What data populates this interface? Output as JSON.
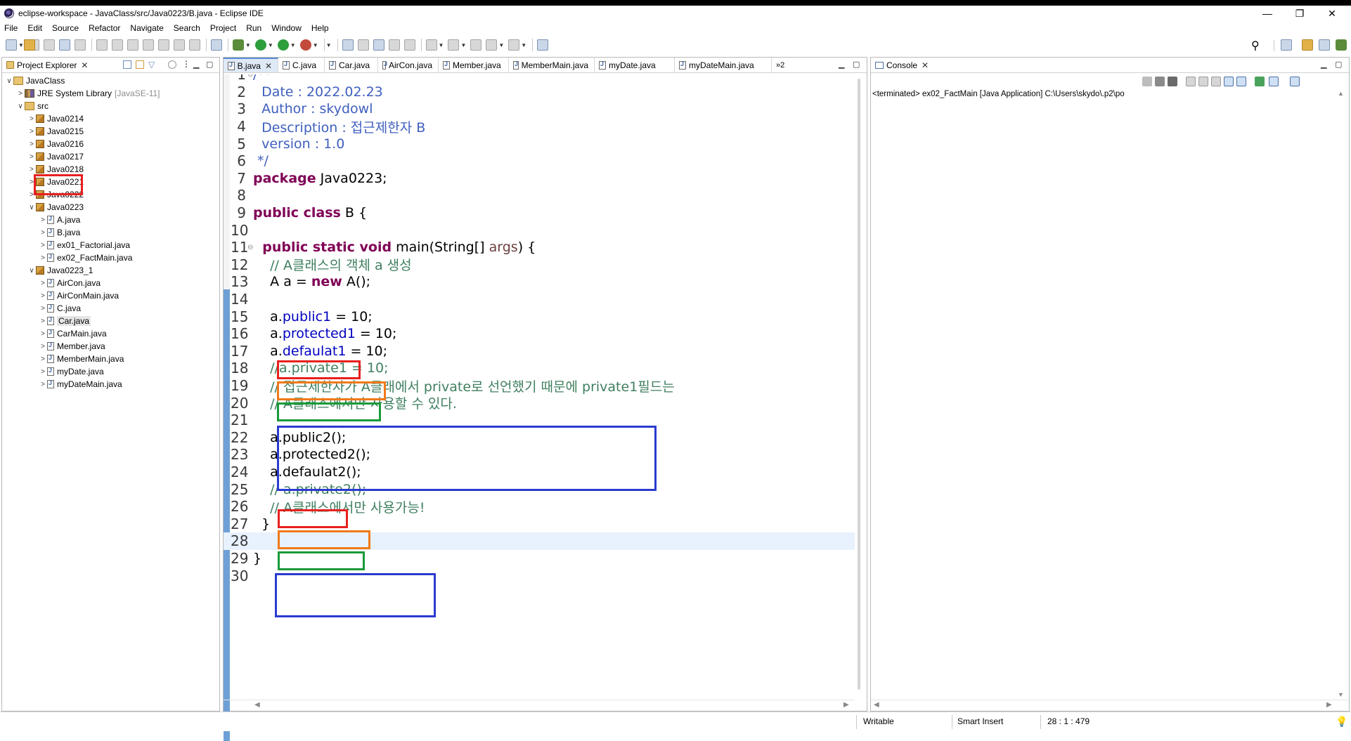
{
  "window": {
    "title": "eclipse-workspace - JavaClass/src/Java0223/B.java - Eclipse IDE",
    "controls": [
      "—",
      "❐",
      "✕"
    ]
  },
  "menu": [
    "File",
    "Edit",
    "Source",
    "Refactor",
    "Navigate",
    "Search",
    "Project",
    "Run",
    "Window",
    "Help"
  ],
  "explorer": {
    "title": "Project Explorer",
    "tree": [
      {
        "label": "JavaClass",
        "kind": "project",
        "chev": "∨",
        "depth": 0
      },
      {
        "label": "JRE System Library",
        "extra": "[JavaSE-11]",
        "kind": "library",
        "chev": ">",
        "depth": 1
      },
      {
        "label": "src",
        "kind": "src",
        "chev": "∨",
        "depth": 1
      },
      {
        "label": "Java0214",
        "kind": "package",
        "chev": ">",
        "depth": 2
      },
      {
        "label": "Java0215",
        "kind": "package",
        "chev": ">",
        "depth": 2
      },
      {
        "label": "Java0216",
        "kind": "package",
        "chev": ">",
        "depth": 2
      },
      {
        "label": "Java0217",
        "kind": "package",
        "chev": ">",
        "depth": 2
      },
      {
        "label": "Java0218",
        "kind": "package",
        "chev": ">",
        "depth": 2
      },
      {
        "label": "Java0221",
        "kind": "package",
        "chev": ">",
        "depth": 2
      },
      {
        "label": "Java0222",
        "kind": "package",
        "chev": ">",
        "depth": 2
      },
      {
        "label": "Java0223",
        "kind": "package",
        "chev": "∨",
        "depth": 2
      },
      {
        "label": "A.java",
        "kind": "file",
        "chev": ">",
        "depth": 3
      },
      {
        "label": "B.java",
        "kind": "file",
        "chev": ">",
        "depth": 3
      },
      {
        "label": "ex01_Factorial.java",
        "kind": "file",
        "chev": ">",
        "depth": 3
      },
      {
        "label": "ex02_FactMain.java",
        "kind": "file",
        "chev": ">",
        "depth": 3
      },
      {
        "label": "Java0223_1",
        "kind": "package",
        "chev": "∨",
        "depth": 2
      },
      {
        "label": "AirCon.java",
        "kind": "file",
        "chev": ">",
        "depth": 3
      },
      {
        "label": "AirConMain.java",
        "kind": "file",
        "chev": ">",
        "depth": 3
      },
      {
        "label": "C.java",
        "kind": "file",
        "chev": ">",
        "depth": 3
      },
      {
        "label": "Car.java",
        "kind": "file",
        "chev": ">",
        "depth": 3,
        "selected": true
      },
      {
        "label": "CarMain.java",
        "kind": "file",
        "chev": ">",
        "depth": 3
      },
      {
        "label": "Member.java",
        "kind": "file",
        "chev": ">",
        "depth": 3
      },
      {
        "label": "MemberMain.java",
        "kind": "file",
        "chev": ">",
        "depth": 3
      },
      {
        "label": "myDate.java",
        "kind": "file",
        "chev": ">",
        "depth": 3
      },
      {
        "label": "myDateMain.java",
        "kind": "file",
        "chev": ">",
        "depth": 3
      }
    ]
  },
  "editor": {
    "tabs": [
      "B.java",
      "C.java",
      "Car.java",
      "AirCon.java",
      "Member.java",
      "MemberMain.java",
      "myDate.java",
      "myDateMain.java"
    ],
    "overflow": "»2",
    "lines": [
      {
        "n": "1",
        "tokens": [
          {
            "t": "/**",
            "c": "doc"
          }
        ],
        "fold": "⊖"
      },
      {
        "n": "2",
        "tokens": [
          {
            "t": "  Date : 2022.02.23",
            "c": "doc"
          }
        ]
      },
      {
        "n": "3",
        "tokens": [
          {
            "t": "  Author : skydowl",
            "c": "doc"
          }
        ]
      },
      {
        "n": "4",
        "tokens": [
          {
            "t": "  Description : 접근제한자 B",
            "c": "doc"
          }
        ]
      },
      {
        "n": "5",
        "tokens": [
          {
            "t": "  version : 1.0",
            "c": "doc"
          }
        ]
      },
      {
        "n": "6",
        "tokens": [
          {
            "t": " */",
            "c": "doc"
          }
        ]
      },
      {
        "n": "7",
        "tokens": [
          {
            "t": "package",
            "c": "kw"
          },
          {
            "t": " Java0223;",
            "c": ""
          }
        ]
      },
      {
        "n": "8",
        "tokens": []
      },
      {
        "n": "9",
        "tokens": [
          {
            "t": "public class",
            "c": "kw"
          },
          {
            "t": " B {",
            "c": ""
          }
        ]
      },
      {
        "n": "10",
        "tokens": []
      },
      {
        "n": "11",
        "tokens": [
          {
            "t": "  public static void",
            "c": "kw"
          },
          {
            "t": " main(String[] ",
            "c": ""
          },
          {
            "t": "args",
            "c": "param"
          },
          {
            "t": ") {",
            "c": ""
          }
        ],
        "fold": "⊖"
      },
      {
        "n": "12",
        "tokens": [
          {
            "t": "    // A클래스의 객체 a 생성",
            "c": "cmt"
          }
        ]
      },
      {
        "n": "13",
        "tokens": [
          {
            "t": "    A a = ",
            "c": ""
          },
          {
            "t": "new",
            "c": "kw"
          },
          {
            "t": " A();",
            "c": ""
          }
        ]
      },
      {
        "n": "14",
        "tokens": []
      },
      {
        "n": "15",
        "tokens": [
          {
            "t": "    a.",
            "c": ""
          },
          {
            "t": "public1",
            "c": "fld"
          },
          {
            "t": " = 10;",
            "c": ""
          }
        ]
      },
      {
        "n": "16",
        "tokens": [
          {
            "t": "    a.",
            "c": ""
          },
          {
            "t": "protected1",
            "c": "fld"
          },
          {
            "t": " = 10;",
            "c": ""
          }
        ]
      },
      {
        "n": "17",
        "tokens": [
          {
            "t": "    a.",
            "c": ""
          },
          {
            "t": "defaulat1",
            "c": "fld"
          },
          {
            "t": " = 10;",
            "c": ""
          }
        ]
      },
      {
        "n": "18",
        "tokens": [
          {
            "t": "    //a.private1 = 10;",
            "c": "cmt"
          }
        ]
      },
      {
        "n": "19",
        "tokens": [
          {
            "t": "    // 접근제한자가 A클래에서 private로 선언했기 때문에 private1필드는",
            "c": "cmt"
          }
        ]
      },
      {
        "n": "20",
        "tokens": [
          {
            "t": "    // A클래스에서만 사용할 수 있다.",
            "c": "cmt"
          }
        ]
      },
      {
        "n": "21",
        "tokens": []
      },
      {
        "n": "22",
        "tokens": [
          {
            "t": "    a.public2();",
            "c": ""
          }
        ]
      },
      {
        "n": "23",
        "tokens": [
          {
            "t": "    a.protected2();",
            "c": ""
          }
        ]
      },
      {
        "n": "24",
        "tokens": [
          {
            "t": "    a.defaulat2();",
            "c": ""
          }
        ]
      },
      {
        "n": "25",
        "tokens": [
          {
            "t": "    // a.private2();",
            "c": "cmt"
          }
        ]
      },
      {
        "n": "26",
        "tokens": [
          {
            "t": "    // A클래스에서만 사용가능!",
            "c": "cmt"
          }
        ]
      },
      {
        "n": "27",
        "tokens": [
          {
            "t": "  }",
            "c": ""
          }
        ]
      },
      {
        "n": "28",
        "tokens": [],
        "current": true
      },
      {
        "n": "29",
        "tokens": [
          {
            "t": "}",
            "c": ""
          }
        ]
      },
      {
        "n": "30",
        "tokens": []
      }
    ]
  },
  "console": {
    "title": "Console",
    "text": "<terminated> ex02_FactMain [Java Application] C:\\Users\\skydo\\.p2\\po"
  },
  "status": {
    "writable": "Writable",
    "insert_mode": "Smart Insert",
    "position": "28 : 1 : 479"
  },
  "colors": {
    "annotation_red": "#e8201e",
    "annotation_orange": "#f07a1a",
    "annotation_green": "#1a9a3a",
    "annotation_blue": "#2b3bcf"
  }
}
